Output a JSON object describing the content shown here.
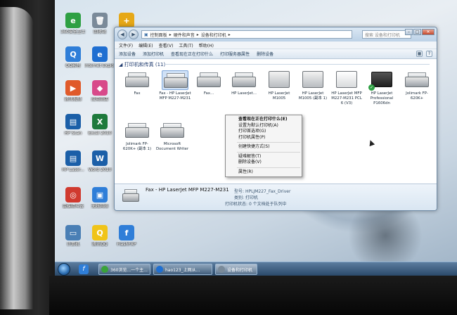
{
  "desktop_icons": [
    {
      "label": "360安全卫士",
      "color": "#2ea043",
      "glyph": "e"
    },
    {
      "label": "回收站",
      "color": "#7a8a99",
      "glyph": "🗑"
    },
    {
      "label": "",
      "color": "#e6a817",
      "glyph": "+"
    },
    {
      "label": "QQ影音",
      "color": "#2f7ed8",
      "glyph": "Q"
    },
    {
      "label": "Internet Explorer",
      "color": "#1f6fd1",
      "glyph": "e"
    },
    {
      "label": "腾讯视频",
      "color": "#e05a2a",
      "glyph": "▶"
    },
    {
      "label": "应用商店",
      "color": "#d84a8a",
      "glyph": "◆"
    },
    {
      "label": "HP Scan",
      "color": "#1b5fa8",
      "glyph": "▤"
    },
    {
      "label": "Excel 2010",
      "color": "#1e7a3c",
      "glyph": "X"
    },
    {
      "label": "Word 2010",
      "color": "#1b5fa8",
      "glyph": "W"
    },
    {
      "label": "HP Laser...",
      "color": "#1b5fa8",
      "glyph": "▤"
    },
    {
      "label": "金蝶精斗云",
      "color": "#d03a2f",
      "glyph": "◎"
    },
    {
      "label": "无线网络",
      "color": "#2f7ed8",
      "glyph": "▣"
    },
    {
      "label": "计算机",
      "color": "#4a7fb5",
      "glyph": "▭"
    },
    {
      "label": "腾讯QQ",
      "color": "#f0c419",
      "glyph": "Q"
    },
    {
      "label": "FlashFXP",
      "color": "#2f7ed8",
      "glyph": "f"
    }
  ],
  "window": {
    "breadcrumb": [
      "控制面板",
      "硬件和声音",
      "设备和打印机"
    ],
    "search_placeholder": "搜索 设备和打印机",
    "menu": [
      "文件(F)",
      "编辑(E)",
      "查看(V)",
      "工具(T)",
      "帮助(H)"
    ],
    "commands": [
      "添加设备",
      "添加打印机",
      "查看现在正在打印什么",
      "打印服务器属性",
      "删除设备"
    ],
    "group_header": "打印机和传真 (11)",
    "devices": [
      {
        "label": "Fax",
        "kind": "fax"
      },
      {
        "label": "Fax - HP LaserJet MFP M227-M231",
        "kind": "fax-sel"
      },
      {
        "label": "Fax...",
        "kind": "fax"
      },
      {
        "label": "HP LaserJet...",
        "kind": "fax"
      },
      {
        "label": "HP LaserJet M1005",
        "kind": "mfp"
      },
      {
        "label": "HP LaserJet M1005 (副本 1)",
        "kind": "mfp"
      },
      {
        "label": "HP LaserJet MFP M227-M231 PCL 6 (V3)",
        "kind": "mfp-white"
      },
      {
        "label": "HP LaserJet Professional P1606dn",
        "kind": "dark"
      },
      {
        "label": "Jolimark FP-620K+",
        "kind": "fax"
      },
      {
        "label": "Jolimark FP-620K+ (副本 1)",
        "kind": "fax"
      },
      {
        "label": "Microsoft Document Writer",
        "kind": "fax"
      }
    ],
    "details": {
      "name": "Fax - HP LaserJet MFP M227-M231",
      "model_key": "型号:",
      "model_val": "HPLJM227_Fax_Driver",
      "category_key": "类别:",
      "category_val": "打印机",
      "status_key": "打印机状态:",
      "status_val": "0 个文档处于队列中"
    }
  },
  "context_menu": [
    {
      "label": "查看现在正在打印什么(E)",
      "bold": true
    },
    {
      "label": "设置为默认打印机(A)"
    },
    {
      "label": "打印首选项(G)"
    },
    {
      "label": "打印机属性(P)"
    },
    {
      "sep": true
    },
    {
      "label": "创建快捷方式(S)"
    },
    {
      "sep": true
    },
    {
      "label": "疑难解答(T)"
    },
    {
      "label": "删除设备(V)"
    },
    {
      "sep": true
    },
    {
      "label": "属性(R)"
    }
  ],
  "taskbar": {
    "buttons": [
      {
        "label": "360浏览...一个主...",
        "color": "#3aa23a"
      },
      {
        "label": "hao123_上网从...",
        "color": "#1f6fd1"
      },
      {
        "label": "设备和打印机",
        "color": "#7a8a99"
      }
    ]
  }
}
